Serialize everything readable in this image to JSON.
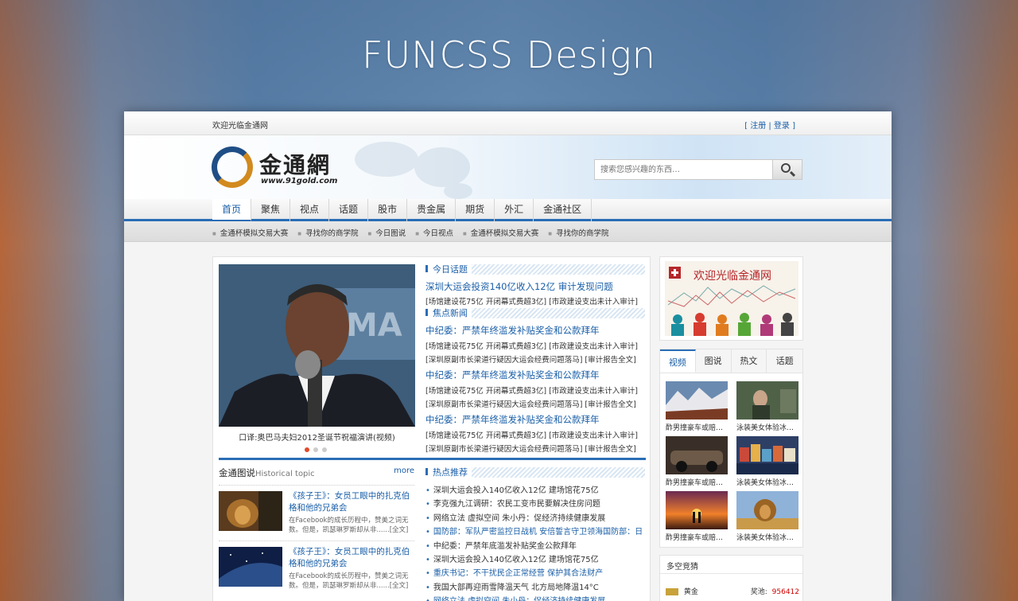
{
  "hero_title": "FUNCSS Design",
  "topbar": {
    "welcome": "欢迎光临金通网",
    "auth": "[ 注册 | 登录 ]"
  },
  "logo": {
    "name": "金通網",
    "url": "www.91gold.com"
  },
  "search": {
    "placeholder": "搜索您感兴趣的东西…"
  },
  "nav": [
    "首页",
    "聚焦",
    "视点",
    "话题",
    "股市",
    "贵金属",
    "期货",
    "外汇",
    "金通社区"
  ],
  "subnav": [
    "金通杯模拟交易大赛",
    "寻找你的商学院",
    "今日图说",
    "今日视点",
    "金通杯模拟交易大赛",
    "寻找你的商学院"
  ],
  "feature": {
    "caption": "口译:奥巴马夫妇2012圣诞节祝福演讲(视频)"
  },
  "today": {
    "title": "今日话题",
    "headline": "深圳大运会投资140亿收入12亿 审计发现问题",
    "sub": "[场馆建设花75亿 开闭幕式费超3亿] [市政建设支出未计入审计]"
  },
  "focus": {
    "title": "焦点新闻",
    "items": [
      {
        "headline": "中纪委：严禁年终滥发补贴奖金和公款拜年",
        "sub1": "[场馆建设花75亿 开闭幕式费超3亿] [市政建设支出未计入审计]",
        "sub2": "[深圳原副市长梁道行疑因大运会经费问题落马] [审计报告全文]"
      },
      {
        "headline": "中纪委：严禁年终滥发补贴奖金和公款拜年",
        "sub1": "[场馆建设花75亿 开闭幕式费超3亿] [市政建设支出未计入审计]",
        "sub2": "[深圳原副市长梁道行疑因大运会经费问题落马] [审计报告全文]"
      },
      {
        "headline": "中纪委：严禁年终滥发补贴奖金和公款拜年",
        "sub1": "[场馆建设花75亿 开闭幕式费超3亿] [市政建设支出未计入审计]",
        "sub2": "[深圳原副市长梁道行疑因大运会经费问题落马] [审计报告全文]"
      }
    ]
  },
  "gallery": {
    "title": "金通图说",
    "subtitle": "Historical topic",
    "more": "more",
    "items": [
      {
        "title": "《孩子王》：女员工眼中的扎克伯格和他的兄弟会",
        "desc": "在Facebook的成长历程中，赞美之词无数。但是，凯瑟琳罗斯却从非......[全文]"
      },
      {
        "title": "《孩子王》：女员工眼中的扎克伯格和他的兄弟会",
        "desc": "在Facebook的成长历程中，赞美之词无数。但是，凯瑟琳罗斯却从非......[全文]"
      }
    ]
  },
  "hot": {
    "title": "热点推荐",
    "items": [
      {
        "text": "深圳大运会投入140亿收入12亿 建场馆花75亿",
        "blue": false
      },
      {
        "text": "李克强九江调研：农民工变市民要解决住房问题",
        "blue": false
      },
      {
        "text": "网络立法 虚拟空间 朱小丹：促经济持续健康发展",
        "blue": false
      },
      {
        "text": "国防部：军队严密监控日战机 安倍誓言守卫领海国防部：日",
        "blue": true
      },
      {
        "text": "中纪委：严禁年底滥发补贴奖金公款拜年",
        "blue": false
      },
      {
        "text": "深圳大运会投入140亿收入12亿 建场馆花75亿",
        "blue": false
      },
      {
        "text": "重庆书记：不干扰民企正常经营 保护其合法财产",
        "blue": true
      },
      {
        "text": "我国大部再迎雨雪降温天气 北方局地降温14°C",
        "blue": false
      },
      {
        "text": "网络立法 虚拟空间 朱小丹：促经济持续健康发展",
        "blue": true
      }
    ]
  },
  "banner": {
    "text": "欢迎光临金通网"
  },
  "video_tabs": [
    "视频",
    "图说",
    "热文",
    "话题"
  ],
  "videos": [
    {
      "title": "酢男撞豪车或赔…",
      "theme": "mountains"
    },
    {
      "title": "泳装美女体验冰…",
      "theme": "woman"
    },
    {
      "title": "酢男撞豪车或赔…",
      "theme": "car"
    },
    {
      "title": "泳装美女体验冰…",
      "theme": "town"
    },
    {
      "title": "酢男撞豪车或赔…",
      "theme": "sunset"
    },
    {
      "title": "泳装美女体验冰…",
      "theme": "lion"
    }
  ],
  "odds": {
    "title": "多空竞猜",
    "item": "黄金",
    "pool_label": "奖池:",
    "pool_value": "956412"
  },
  "colors": {
    "accent": "#2a6db5",
    "link": "#1a5fa8",
    "highlight": "#d00000"
  }
}
